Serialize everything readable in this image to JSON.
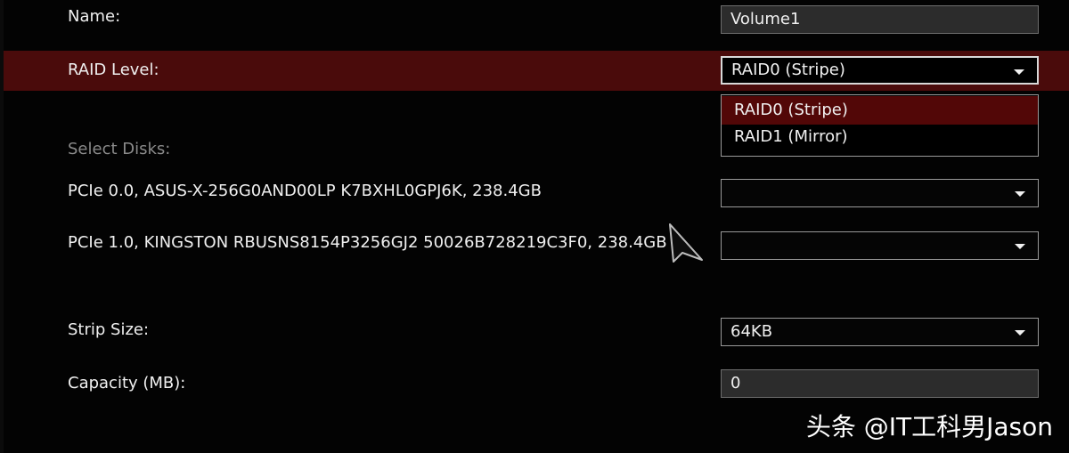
{
  "fields": {
    "name": {
      "label": "Name:",
      "value": "Volume1"
    },
    "raid_level": {
      "label": "RAID Level:",
      "value": "RAID0 (Stripe)",
      "options": [
        "RAID0 (Stripe)",
        "RAID1 (Mirror)"
      ]
    },
    "select_disks": {
      "label": "Select Disks:",
      "disks": [
        {
          "label": "PCIe 0.0, ASUS-X-256G0AND00LP K7BXHL0GPJ6K, 238.4GB",
          "value": ""
        },
        {
          "label": "PCIe 1.0, KINGSTON RBUSNS8154P3256GJ2 50026B728219C3F0, 238.4GB",
          "value": ""
        }
      ]
    },
    "strip_size": {
      "label": "Strip Size:",
      "value": "64KB"
    },
    "capacity": {
      "label": "Capacity (MB):",
      "value": "0"
    }
  },
  "icons": {
    "caret": "chevron-down-icon",
    "cursor": "mouse-pointer-icon"
  },
  "colors": {
    "highlight_row": "#4a0b0b",
    "selected_option": "#520707"
  },
  "watermark": "头条 @IT工科男Jason"
}
